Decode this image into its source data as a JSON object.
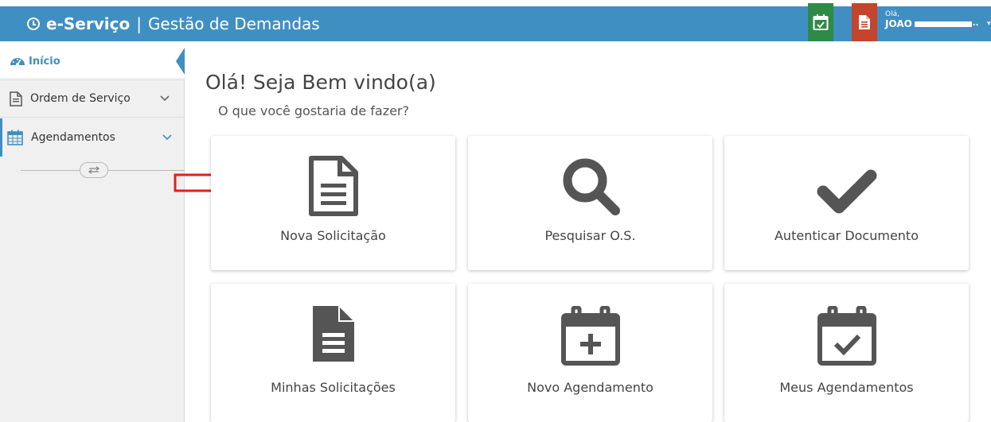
{
  "header": {
    "brand_name": "e-Serviço",
    "separator": "|",
    "brand_sub": "Gestão de Demandas",
    "user_greeting": "Olá,",
    "user_name": "JOAO",
    "colors": {
      "bar": "#3f8fc3",
      "agenda_button": "#2e8b47",
      "doc_button": "#c4452c"
    },
    "icons": [
      "calendar-check-icon",
      "document-icon"
    ]
  },
  "sidebar": {
    "items": [
      {
        "label": "Início",
        "icon": "dashboard-icon",
        "active": true
      },
      {
        "label": "Ordem de Serviço",
        "icon": "document-icon",
        "expandable": true
      },
      {
        "label": "Agendamentos",
        "icon": "calendar-icon",
        "expandable": true
      }
    ],
    "toggle_icon": "swap-arrows-icon"
  },
  "main": {
    "welcome": "Olá! Seja Bem vindo(a)",
    "question": "O que você gostaria de fazer?",
    "tiles": [
      {
        "label": "Nova Solicitação",
        "icon": "document-outline-icon"
      },
      {
        "label": "Pesquisar O.S.",
        "icon": "search-icon"
      },
      {
        "label": "Autenticar Documento",
        "icon": "checkmark-icon"
      },
      {
        "label": "Minhas Solicitações",
        "icon": "document-filled-icon"
      },
      {
        "label": "Novo Agendamento",
        "icon": "calendar-plus-icon"
      },
      {
        "label": "Meus Agendamentos",
        "icon": "calendar-check-icon"
      }
    ]
  }
}
